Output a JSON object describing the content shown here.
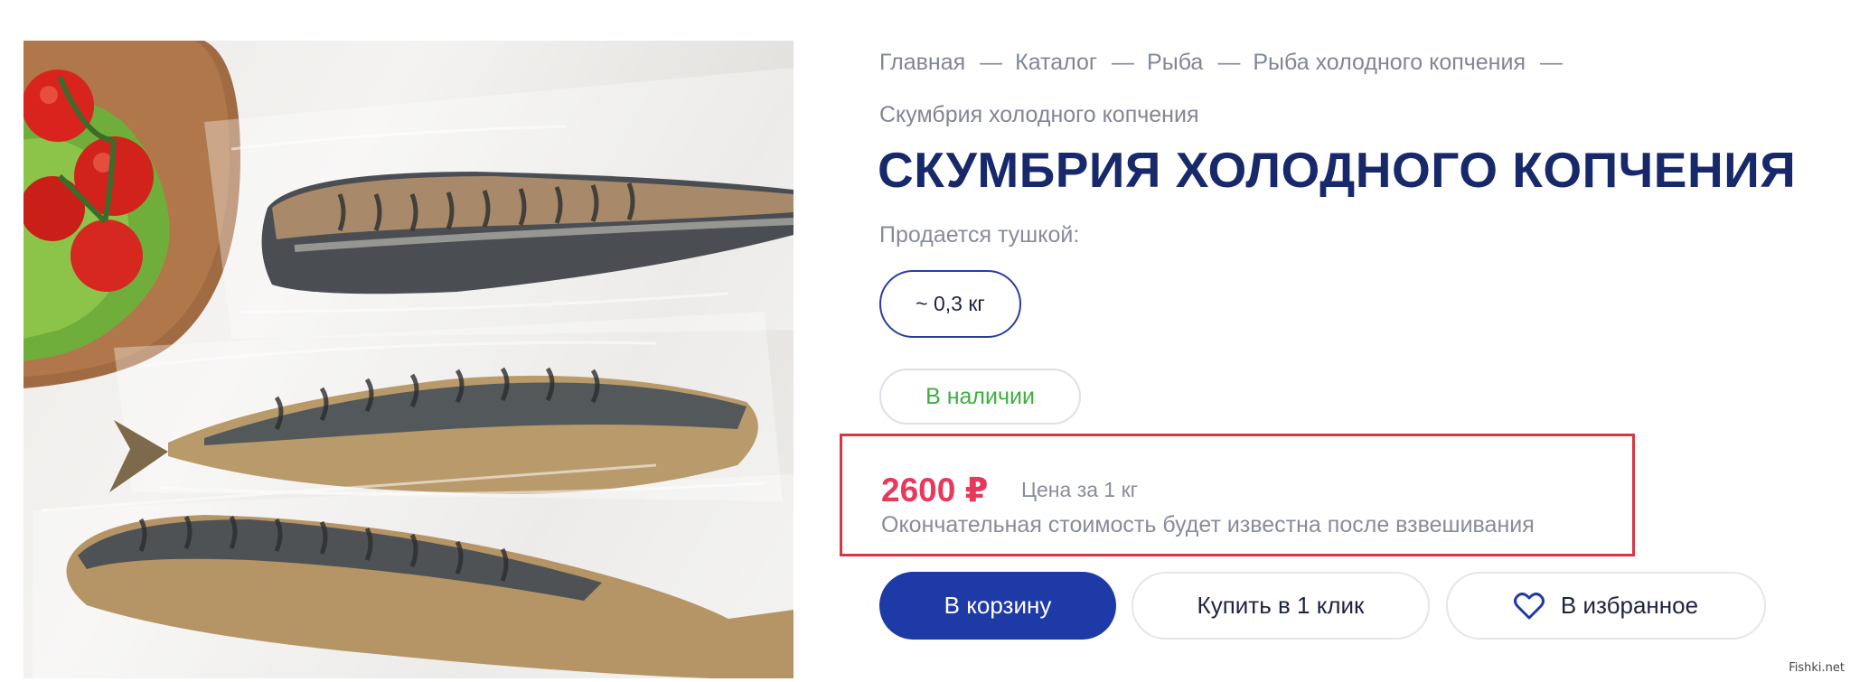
{
  "breadcrumb": {
    "items": [
      "Главная",
      "Каталог",
      "Рыба",
      "Рыба холодного копчения"
    ],
    "current": "Скумбрия холодного копчения",
    "separator": "—"
  },
  "product": {
    "title": "СКУМБРИЯ ХОЛОДНОГО КОПЧЕНИЯ",
    "sold_as_label": "Продается тушкой:",
    "weight_option": "~ 0,3 кг",
    "stock_status": "В наличии",
    "price": "2600 ₽",
    "price_unit": "Цена за 1 кг",
    "price_note": "Окончательная стоимость будет известна после взвешивания"
  },
  "actions": {
    "cart_label": "В корзину",
    "one_click_label": "Купить в 1 клик",
    "favorite_label": "В избранное",
    "favorite_icon": "heart-icon"
  },
  "watermark": "Fishki.net",
  "colors": {
    "brand_navy": "#17296b",
    "primary_button": "#1e3aa6",
    "price_red": "#e63a5d",
    "in_stock_green": "#3fae3f",
    "highlight_frame": "#d93645"
  }
}
